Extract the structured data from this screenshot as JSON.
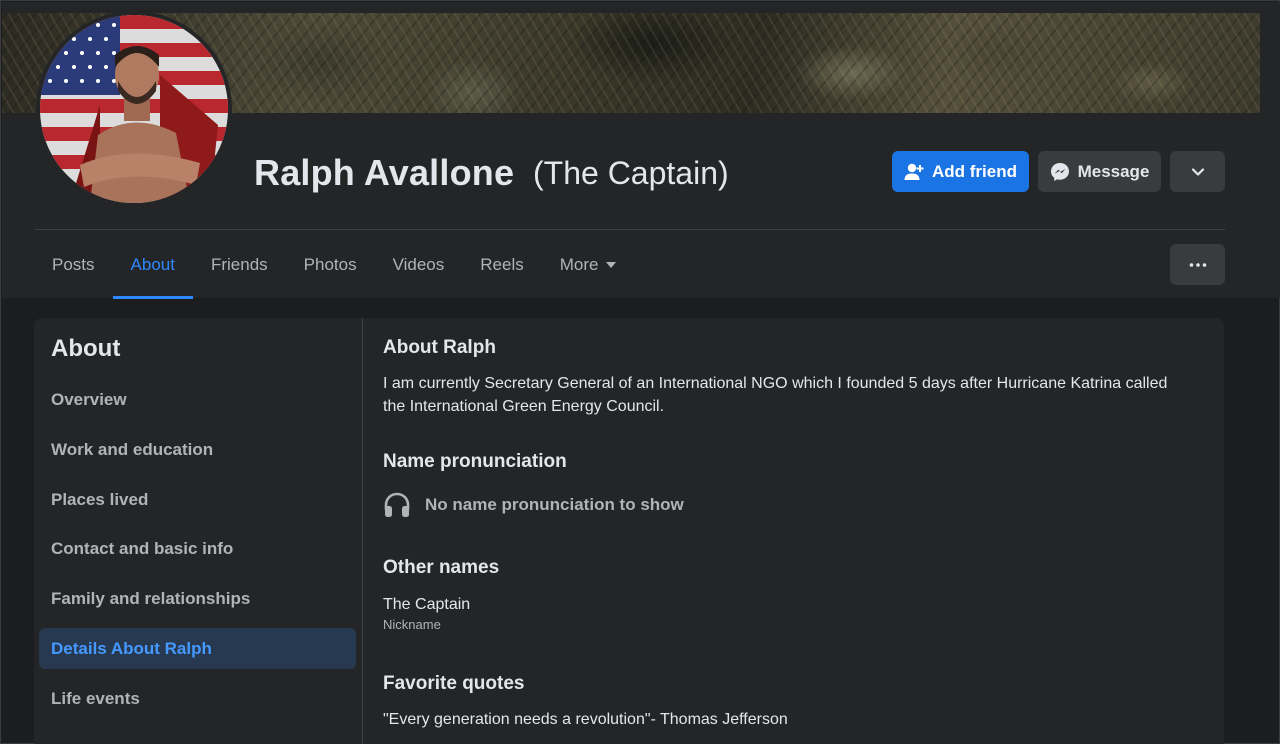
{
  "profile": {
    "name": "Ralph Avallone",
    "alternate_name": "(The Captain)"
  },
  "actions": {
    "add_friend": "Add friend",
    "message": "Message"
  },
  "tabs": [
    {
      "label": "Posts"
    },
    {
      "label": "About"
    },
    {
      "label": "Friends"
    },
    {
      "label": "Photos"
    },
    {
      "label": "Videos"
    },
    {
      "label": "Reels"
    },
    {
      "label": "More"
    }
  ],
  "active_tab": "About",
  "about": {
    "title": "About",
    "sidebar": [
      {
        "label": "Overview"
      },
      {
        "label": "Work and education"
      },
      {
        "label": "Places lived"
      },
      {
        "label": "Contact and basic info"
      },
      {
        "label": "Family and relationships"
      },
      {
        "label": "Details About Ralph"
      },
      {
        "label": "Life events"
      }
    ],
    "active_item": "Details About Ralph",
    "sections": {
      "about_heading": "About Ralph",
      "about_text": "I am currently Secretary General of an International NGO which I founded 5 days after Hurricane Katrina called the International Green Energy Council.",
      "pronunciation_heading": "Name pronunciation",
      "pronunciation_text": "No name pronunciation to show",
      "other_names_heading": "Other names",
      "other_name_value": "The Captain",
      "other_name_type": "Nickname",
      "quotes_heading": "Favorite quotes",
      "quote_text": "\"Every generation needs a revolution\"- Thomas Jefferson"
    }
  },
  "colors": {
    "accent": "#2d88ff",
    "primary_button": "#1b74e4",
    "surface": "#242526",
    "background": "#18191a",
    "secondary_button": "#3a3b3c",
    "active_sidebar_bg": "#263951"
  },
  "icons": {
    "add_friend": "person-plus-icon",
    "message": "messenger-icon",
    "dropdown": "chevron-down-icon",
    "more_tab": "caret-down-icon",
    "options": "ellipsis-icon",
    "pronunciation": "headphones-icon"
  }
}
